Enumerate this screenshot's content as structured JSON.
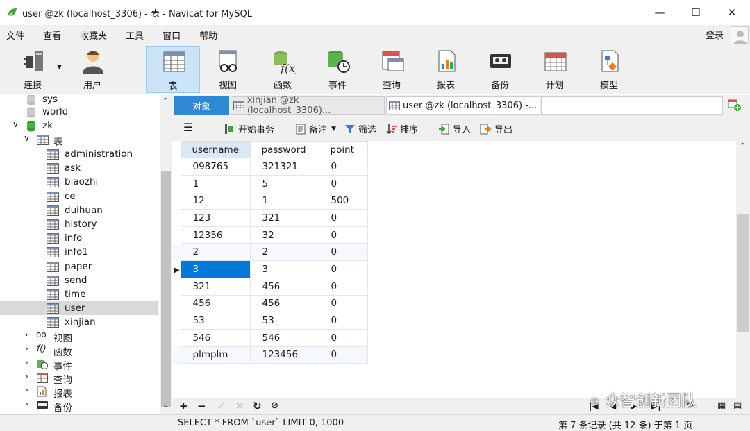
{
  "window": {
    "title": "user @zk (localhost_3306) - 表 - Navicat for MySQL"
  },
  "menu": [
    "文件",
    "查看",
    "收藏夹",
    "工具",
    "窗口",
    "帮助"
  ],
  "login_label": "登录",
  "toolbar": {
    "connect": "连接",
    "user": "用户",
    "table": "表",
    "view": "视图",
    "function": "函数",
    "event": "事件",
    "query": "查询",
    "report": "报表",
    "backup": "备份",
    "schedule": "计划",
    "model": "模型"
  },
  "tree": {
    "sys": "sys",
    "world": "world",
    "zk": "zk",
    "tables": "表",
    "table_items": [
      "administration",
      "ask",
      "biaozhi",
      "ce",
      "duihuan",
      "history",
      "info",
      "info1",
      "paper",
      "send",
      "time",
      "user",
      "xinjian"
    ],
    "views": "视图",
    "functions": "函数",
    "events": "事件",
    "queries": "查询",
    "reports": "报表",
    "backups": "备份"
  },
  "tabs": {
    "objects": "对象",
    "tab1": "xinjian @zk (localhost_3306)...",
    "tab2": "user @zk (localhost_3306) -..."
  },
  "subtoolbar": {
    "begin_tx": "开始事务",
    "memo": "备注",
    "filter": "筛选",
    "sort": "排序",
    "import": "导入",
    "export": "导出"
  },
  "grid": {
    "columns": [
      "username",
      "password",
      "point"
    ],
    "rows": [
      [
        "098765",
        "321321",
        "0"
      ],
      [
        "1",
        "5",
        "0"
      ],
      [
        "12",
        "1",
        "500"
      ],
      [
        "123",
        "321",
        "0"
      ],
      [
        "12356",
        "32",
        "0"
      ],
      [
        "2",
        "2",
        "0"
      ],
      [
        "3",
        "3",
        "0"
      ],
      [
        "321",
        "456",
        "0"
      ],
      [
        "456",
        "456",
        "0"
      ],
      [
        "53",
        "53",
        "0"
      ],
      [
        "546",
        "546",
        "0"
      ],
      [
        "plmplm",
        "123456",
        "0"
      ]
    ],
    "selected_row": 6
  },
  "status": {
    "sql": "SELECT * FROM `user` LIMIT 0, 1000",
    "page": "第 7 条记录 (共 12 条) 于第 1 页"
  },
  "watermark": "众智创新团队",
  "colors": {
    "accent": "#0078d7",
    "tab_active": "#2d88d6",
    "toolbar_active": "#cce4f7"
  }
}
